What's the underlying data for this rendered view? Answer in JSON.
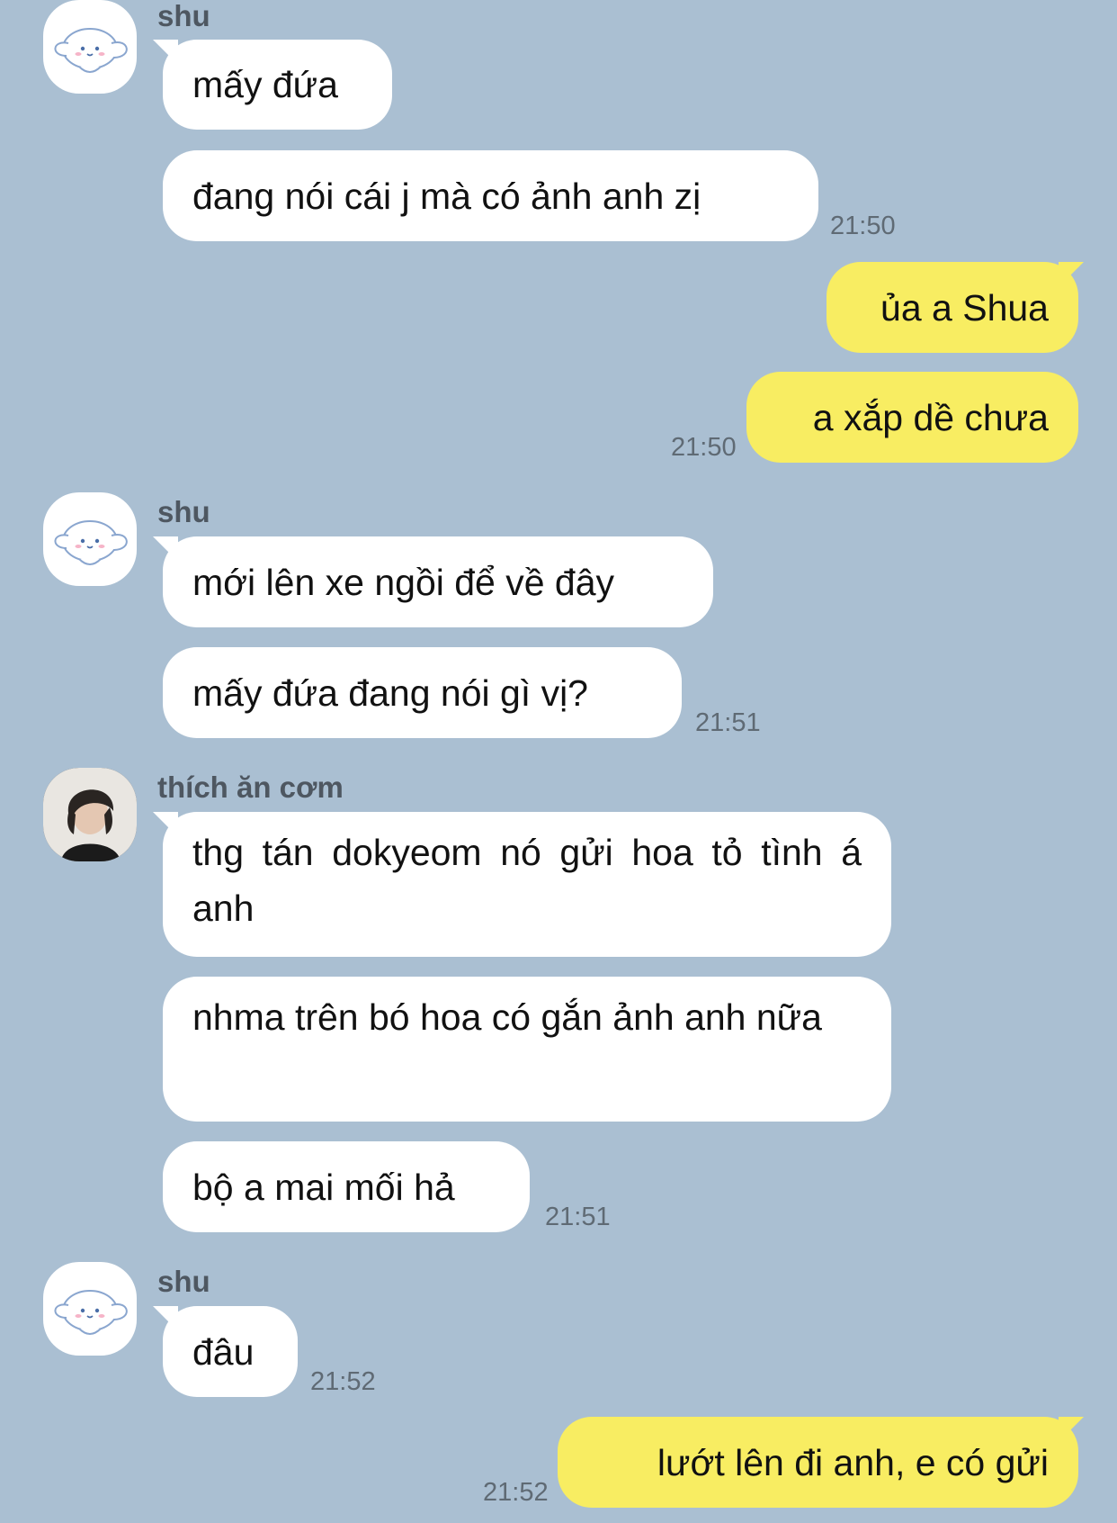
{
  "messages": {
    "g1_sender": "shu",
    "g1_m1": "mấy đứa",
    "g1_m2": "đang nói cái j mà có ảnh anh zị",
    "g1_time": "21:50",
    "o1_m1": "ủa a Shua",
    "o1_m2": "a xắp dề chưa",
    "o1_time": "21:50",
    "g2_sender": "shu",
    "g2_m1": "mới lên xe ngồi để về đây",
    "g2_m2": "mấy đứa đang nói gì vị?",
    "g2_time": "21:51",
    "g3_sender": "thích ăn cơm",
    "g3_m1": "thg tán dokyeom nó gửi hoa tỏ tình á anh",
    "g3_m2": "nhma trên bó hoa có gắn ảnh anh nữa",
    "g3_m3": "bộ a mai mối hả",
    "g3_time": "21:51",
    "g4_sender": "shu",
    "g4_m1": "đâu",
    "g4_time": "21:52",
    "o2_m1": "lướt lên đi anh, e có gửi",
    "o2_time": "21:52"
  },
  "colors": {
    "background": "#aabfd2",
    "incoming_bubble": "#ffffff",
    "outgoing_bubble": "#f8ed62"
  },
  "icons": {
    "shu_avatar": "cinnamoroll-avatar-icon",
    "thich_an_com_avatar": "profile-photo-avatar"
  }
}
